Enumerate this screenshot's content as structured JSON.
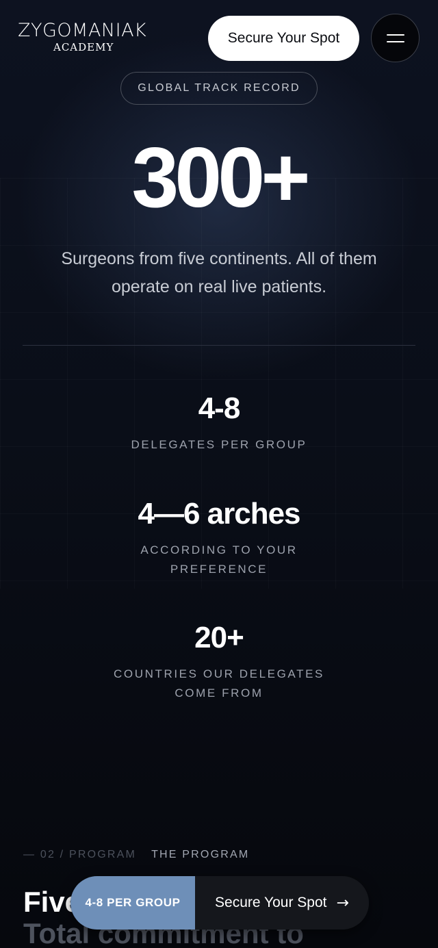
{
  "header": {
    "logo_main": "ZYGOMANIAK",
    "logo_sub": "ACADEMY",
    "cta_label": "Secure Your Spot",
    "menu_icon": "hamburger-menu-icon"
  },
  "hero": {
    "pill_label": "GLOBAL TRACK RECORD",
    "big_number": "300+",
    "lead": "Surgeons from five continents. All of them operate on real live patients."
  },
  "stats": [
    {
      "value": "4-8",
      "label": "DELEGATES PER GROUP"
    },
    {
      "value": "4—6 arches",
      "label": "ACCORDING TO YOUR PREFERENCE"
    },
    {
      "value": "20+",
      "label": "COUNTRIES OUR DELEGATES COME FROM"
    }
  ],
  "program": {
    "index": "— 02 / PROGRAM",
    "name": "THE PROGRAM",
    "heading_line1": "Five",
    "heading_line2": "Total commitment to"
  },
  "sticky_bar": {
    "badge": "4-8 PER GROUP",
    "cta_label": "Secure Your Spot",
    "cta_icon": "arrow-right-icon",
    "badge_color": "#6e8fb8"
  }
}
